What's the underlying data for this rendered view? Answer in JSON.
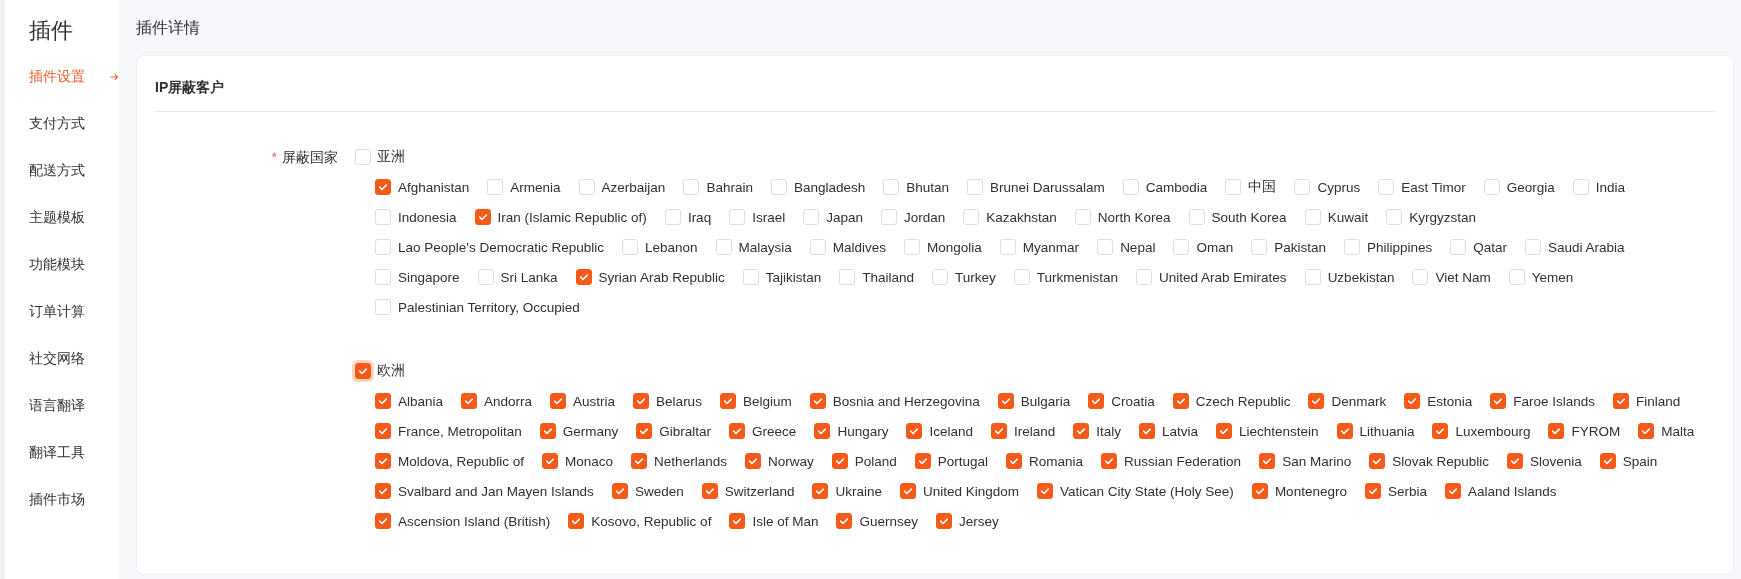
{
  "sidebar": {
    "title": "插件",
    "items": [
      {
        "label": "插件设置",
        "selected": true
      },
      {
        "label": "支付方式",
        "selected": false
      },
      {
        "label": "配送方式",
        "selected": false
      },
      {
        "label": "主题模板",
        "selected": false
      },
      {
        "label": "功能模块",
        "selected": false
      },
      {
        "label": "订单计算",
        "selected": false
      },
      {
        "label": "社交网络",
        "selected": false
      },
      {
        "label": "语言翻译",
        "selected": false
      },
      {
        "label": "翻译工具",
        "selected": false
      },
      {
        "label": "插件市场",
        "selected": false
      }
    ]
  },
  "page_title": "插件详情",
  "card": {
    "title": "IP屏蔽客户",
    "field": {
      "label": "屏蔽国家",
      "required_mark": "*",
      "groups": [
        {
          "label": "亚洲",
          "checked": false,
          "focused": false,
          "countries": [
            {
              "label": "Afghanistan",
              "checked": true
            },
            {
              "label": "Armenia",
              "checked": false
            },
            {
              "label": "Azerbaijan",
              "checked": false
            },
            {
              "label": "Bahrain",
              "checked": false
            },
            {
              "label": "Bangladesh",
              "checked": false
            },
            {
              "label": "Bhutan",
              "checked": false
            },
            {
              "label": "Brunei Darussalam",
              "checked": false
            },
            {
              "label": "Cambodia",
              "checked": false
            },
            {
              "label": "中国",
              "checked": false
            },
            {
              "label": "Cyprus",
              "checked": false
            },
            {
              "label": "East Timor",
              "checked": false
            },
            {
              "label": "Georgia",
              "checked": false
            },
            {
              "label": "India",
              "checked": false
            },
            {
              "label": "Indonesia",
              "checked": false
            },
            {
              "label": "Iran (Islamic Republic of)",
              "checked": true
            },
            {
              "label": "Iraq",
              "checked": false
            },
            {
              "label": "Israel",
              "checked": false
            },
            {
              "label": "Japan",
              "checked": false
            },
            {
              "label": "Jordan",
              "checked": false
            },
            {
              "label": "Kazakhstan",
              "checked": false
            },
            {
              "label": "North Korea",
              "checked": false
            },
            {
              "label": "South Korea",
              "checked": false
            },
            {
              "label": "Kuwait",
              "checked": false
            },
            {
              "label": "Kyrgyzstan",
              "checked": false
            },
            {
              "label": "Lao People's Democratic Republic",
              "checked": false
            },
            {
              "label": "Lebanon",
              "checked": false
            },
            {
              "label": "Malaysia",
              "checked": false
            },
            {
              "label": "Maldives",
              "checked": false
            },
            {
              "label": "Mongolia",
              "checked": false
            },
            {
              "label": "Myanmar",
              "checked": false
            },
            {
              "label": "Nepal",
              "checked": false
            },
            {
              "label": "Oman",
              "checked": false
            },
            {
              "label": "Pakistan",
              "checked": false
            },
            {
              "label": "Philippines",
              "checked": false
            },
            {
              "label": "Qatar",
              "checked": false
            },
            {
              "label": "Saudi Arabia",
              "checked": false
            },
            {
              "label": "Singapore",
              "checked": false
            },
            {
              "label": "Sri Lanka",
              "checked": false
            },
            {
              "label": "Syrian Arab Republic",
              "checked": true
            },
            {
              "label": "Tajikistan",
              "checked": false
            },
            {
              "label": "Thailand",
              "checked": false
            },
            {
              "label": "Turkey",
              "checked": false
            },
            {
              "label": "Turkmenistan",
              "checked": false
            },
            {
              "label": "United Arab Emirates",
              "checked": false
            },
            {
              "label": "Uzbekistan",
              "checked": false
            },
            {
              "label": "Viet Nam",
              "checked": false
            },
            {
              "label": "Yemen",
              "checked": false
            },
            {
              "label": "Palestinian Territory, Occupied",
              "checked": false
            }
          ]
        },
        {
          "label": "欧洲",
          "checked": true,
          "focused": true,
          "countries": [
            {
              "label": "Albania",
              "checked": true
            },
            {
              "label": "Andorra",
              "checked": true
            },
            {
              "label": "Austria",
              "checked": true
            },
            {
              "label": "Belarus",
              "checked": true
            },
            {
              "label": "Belgium",
              "checked": true
            },
            {
              "label": "Bosnia and Herzegovina",
              "checked": true
            },
            {
              "label": "Bulgaria",
              "checked": true
            },
            {
              "label": "Croatia",
              "checked": true
            },
            {
              "label": "Czech Republic",
              "checked": true
            },
            {
              "label": "Denmark",
              "checked": true
            },
            {
              "label": "Estonia",
              "checked": true
            },
            {
              "label": "Faroe Islands",
              "checked": true
            },
            {
              "label": "Finland",
              "checked": true
            },
            {
              "label": "France, Metropolitan",
              "checked": true
            },
            {
              "label": "Germany",
              "checked": true
            },
            {
              "label": "Gibraltar",
              "checked": true
            },
            {
              "label": "Greece",
              "checked": true
            },
            {
              "label": "Hungary",
              "checked": true
            },
            {
              "label": "Iceland",
              "checked": true
            },
            {
              "label": "Ireland",
              "checked": true
            },
            {
              "label": "Italy",
              "checked": true
            },
            {
              "label": "Latvia",
              "checked": true
            },
            {
              "label": "Liechtenstein",
              "checked": true
            },
            {
              "label": "Lithuania",
              "checked": true
            },
            {
              "label": "Luxembourg",
              "checked": true
            },
            {
              "label": "FYROM",
              "checked": true
            },
            {
              "label": "Malta",
              "checked": true
            },
            {
              "label": "Moldova, Republic of",
              "checked": true
            },
            {
              "label": "Monaco",
              "checked": true
            },
            {
              "label": "Netherlands",
              "checked": true
            },
            {
              "label": "Norway",
              "checked": true
            },
            {
              "label": "Poland",
              "checked": true
            },
            {
              "label": "Portugal",
              "checked": true
            },
            {
              "label": "Romania",
              "checked": true
            },
            {
              "label": "Russian Federation",
              "checked": true
            },
            {
              "label": "San Marino",
              "checked": true
            },
            {
              "label": "Slovak Republic",
              "checked": true
            },
            {
              "label": "Slovenia",
              "checked": true
            },
            {
              "label": "Spain",
              "checked": true
            },
            {
              "label": "Svalbard and Jan Mayen Islands",
              "checked": true
            },
            {
              "label": "Sweden",
              "checked": true
            },
            {
              "label": "Switzerland",
              "checked": true
            },
            {
              "label": "Ukraine",
              "checked": true
            },
            {
              "label": "United Kingdom",
              "checked": true
            },
            {
              "label": "Vatican City State (Holy See)",
              "checked": true
            },
            {
              "label": "Montenegro",
              "checked": true
            },
            {
              "label": "Serbia",
              "checked": true
            },
            {
              "label": "Aaland Islands",
              "checked": true
            },
            {
              "label": "Ascension Island (British)",
              "checked": true
            },
            {
              "label": "Kosovo, Republic of",
              "checked": true
            },
            {
              "label": "Isle of Man",
              "checked": true
            },
            {
              "label": "Guernsey",
              "checked": true
            },
            {
              "label": "Jersey",
              "checked": true
            }
          ]
        }
      ]
    }
  }
}
